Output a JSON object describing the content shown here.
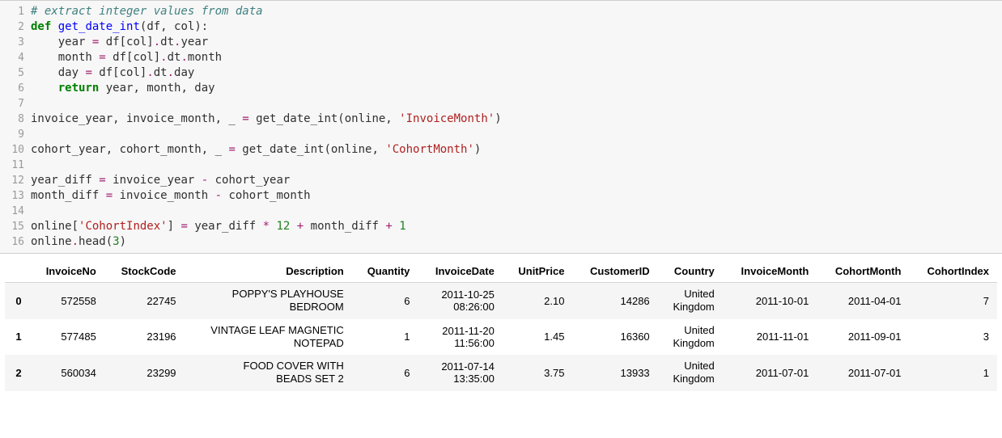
{
  "code_lines": [
    [
      {
        "t": "comment",
        "v": "# extract integer values from data"
      }
    ],
    [
      {
        "t": "keyword",
        "v": "def"
      },
      {
        "t": "plain",
        "v": " "
      },
      {
        "t": "def",
        "v": "get_date_int"
      },
      {
        "t": "plain",
        "v": "(df, col):"
      }
    ],
    [
      {
        "t": "plain",
        "v": "    year "
      },
      {
        "t": "op",
        "v": "="
      },
      {
        "t": "plain",
        "v": " df[col]"
      },
      {
        "t": "op",
        "v": "."
      },
      {
        "t": "plain",
        "v": "dt"
      },
      {
        "t": "op",
        "v": "."
      },
      {
        "t": "plain",
        "v": "year"
      }
    ],
    [
      {
        "t": "plain",
        "v": "    month "
      },
      {
        "t": "op",
        "v": "="
      },
      {
        "t": "plain",
        "v": " df[col]"
      },
      {
        "t": "op",
        "v": "."
      },
      {
        "t": "plain",
        "v": "dt"
      },
      {
        "t": "op",
        "v": "."
      },
      {
        "t": "plain",
        "v": "month"
      }
    ],
    [
      {
        "t": "plain",
        "v": "    day "
      },
      {
        "t": "op",
        "v": "="
      },
      {
        "t": "plain",
        "v": " df[col]"
      },
      {
        "t": "op",
        "v": "."
      },
      {
        "t": "plain",
        "v": "dt"
      },
      {
        "t": "op",
        "v": "."
      },
      {
        "t": "plain",
        "v": "day"
      }
    ],
    [
      {
        "t": "plain",
        "v": "    "
      },
      {
        "t": "keyword",
        "v": "return"
      },
      {
        "t": "plain",
        "v": " year, month, day"
      }
    ],
    [
      {
        "t": "plain",
        "v": ""
      }
    ],
    [
      {
        "t": "plain",
        "v": "invoice_year, invoice_month, _ "
      },
      {
        "t": "op",
        "v": "="
      },
      {
        "t": "plain",
        "v": " get_date_int(online, "
      },
      {
        "t": "string",
        "v": "'InvoiceMonth'"
      },
      {
        "t": "plain",
        "v": ")"
      }
    ],
    [
      {
        "t": "plain",
        "v": ""
      }
    ],
    [
      {
        "t": "plain",
        "v": "cohort_year, cohort_month, _ "
      },
      {
        "t": "op",
        "v": "="
      },
      {
        "t": "plain",
        "v": " get_date_int(online, "
      },
      {
        "t": "string",
        "v": "'CohortMonth'"
      },
      {
        "t": "plain",
        "v": ")"
      }
    ],
    [
      {
        "t": "plain",
        "v": ""
      }
    ],
    [
      {
        "t": "plain",
        "v": "year_diff "
      },
      {
        "t": "op",
        "v": "="
      },
      {
        "t": "plain",
        "v": " invoice_year "
      },
      {
        "t": "op",
        "v": "-"
      },
      {
        "t": "plain",
        "v": " cohort_year"
      }
    ],
    [
      {
        "t": "plain",
        "v": "month_diff "
      },
      {
        "t": "op",
        "v": "="
      },
      {
        "t": "plain",
        "v": " invoice_month "
      },
      {
        "t": "op",
        "v": "-"
      },
      {
        "t": "plain",
        "v": " cohort_month"
      }
    ],
    [
      {
        "t": "plain",
        "v": ""
      }
    ],
    [
      {
        "t": "plain",
        "v": "online["
      },
      {
        "t": "string",
        "v": "'CohortIndex'"
      },
      {
        "t": "plain",
        "v": "] "
      },
      {
        "t": "op",
        "v": "="
      },
      {
        "t": "plain",
        "v": " year_diff "
      },
      {
        "t": "op",
        "v": "*"
      },
      {
        "t": "plain",
        "v": " "
      },
      {
        "t": "num",
        "v": "12"
      },
      {
        "t": "plain",
        "v": " "
      },
      {
        "t": "op",
        "v": "+"
      },
      {
        "t": "plain",
        "v": " month_diff "
      },
      {
        "t": "op",
        "v": "+"
      },
      {
        "t": "plain",
        "v": " "
      },
      {
        "t": "num",
        "v": "1"
      }
    ],
    [
      {
        "t": "plain",
        "v": "online"
      },
      {
        "t": "op",
        "v": "."
      },
      {
        "t": "plain",
        "v": "head("
      },
      {
        "t": "num",
        "v": "3"
      },
      {
        "t": "plain",
        "v": ")"
      }
    ]
  ],
  "table": {
    "columns": [
      "InvoiceNo",
      "StockCode",
      "Description",
      "Quantity",
      "InvoiceDate",
      "UnitPrice",
      "CustomerID",
      "Country",
      "InvoiceMonth",
      "CohortMonth",
      "CohortIndex"
    ],
    "index": [
      "0",
      "1",
      "2"
    ],
    "rows": [
      {
        "InvoiceNo": "572558",
        "StockCode": "22745",
        "Description": "POPPY'S PLAYHOUSE\nBEDROOM",
        "Quantity": "6",
        "InvoiceDate": "2011-10-25\n08:26:00",
        "UnitPrice": "2.10",
        "CustomerID": "14286",
        "Country": "United\nKingdom",
        "InvoiceMonth": "2011-10-01",
        "CohortMonth": "2011-04-01",
        "CohortIndex": "7"
      },
      {
        "InvoiceNo": "577485",
        "StockCode": "23196",
        "Description": "VINTAGE LEAF MAGNETIC\nNOTEPAD",
        "Quantity": "1",
        "InvoiceDate": "2011-11-20\n11:56:00",
        "UnitPrice": "1.45",
        "CustomerID": "16360",
        "Country": "United\nKingdom",
        "InvoiceMonth": "2011-11-01",
        "CohortMonth": "2011-09-01",
        "CohortIndex": "3"
      },
      {
        "InvoiceNo": "560034",
        "StockCode": "23299",
        "Description": "FOOD COVER WITH\nBEADS SET 2",
        "Quantity": "6",
        "InvoiceDate": "2011-07-14\n13:35:00",
        "UnitPrice": "3.75",
        "CustomerID": "13933",
        "Country": "United\nKingdom",
        "InvoiceMonth": "2011-07-01",
        "CohortMonth": "2011-07-01",
        "CohortIndex": "1"
      }
    ]
  }
}
